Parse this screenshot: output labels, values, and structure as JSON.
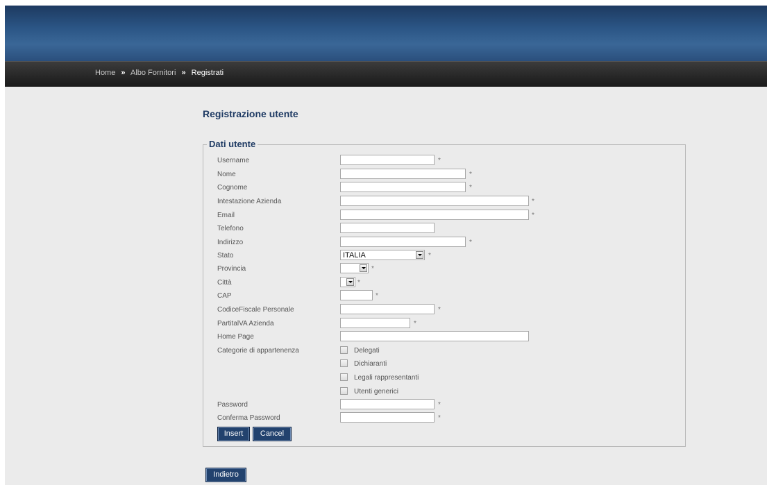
{
  "breadcrumb": {
    "items": [
      "Home",
      "Albo Fornitori",
      "Registrati"
    ],
    "separator": "»"
  },
  "page_title": "Registrazione utente",
  "form": {
    "legend": "Dati utente",
    "required_marker": "*",
    "fields": {
      "username": {
        "label": "Username",
        "value": ""
      },
      "nome": {
        "label": "Nome",
        "value": ""
      },
      "cognome": {
        "label": "Cognome",
        "value": ""
      },
      "intestazione": {
        "label": "Intestazione Azienda",
        "value": ""
      },
      "email": {
        "label": "Email",
        "value": ""
      },
      "telefono": {
        "label": "Telefono",
        "value": ""
      },
      "indirizzo": {
        "label": "Indirizzo",
        "value": ""
      },
      "stato": {
        "label": "Stato",
        "value": "ITALIA"
      },
      "provincia": {
        "label": "Provincia",
        "value": ""
      },
      "citta": {
        "label": "Città",
        "value": ""
      },
      "cap": {
        "label": "CAP",
        "value": ""
      },
      "codice_fiscale": {
        "label": "CodiceFiscale Personale",
        "value": ""
      },
      "partita_iva": {
        "label": "PartitalVA Azienda",
        "value": ""
      },
      "home_page": {
        "label": "Home Page",
        "value": ""
      },
      "categorie": {
        "label": "Categorie di appartenenza",
        "options": [
          {
            "label": "Delegati",
            "checked": false
          },
          {
            "label": "Dichiaranti",
            "checked": false
          },
          {
            "label": "Legali rappresentanti",
            "checked": false
          },
          {
            "label": "Utenti generici",
            "checked": false
          }
        ]
      },
      "password": {
        "label": "Password",
        "value": ""
      },
      "conferma_password": {
        "label": "Conferma Password",
        "value": ""
      }
    },
    "buttons": {
      "insert": "Insert",
      "cancel": "Cancel"
    }
  },
  "back_button": "Indietro",
  "colors": {
    "accent": "#22426e",
    "title": "#1e3a63",
    "content_bg": "#ebebeb",
    "navbar": "#262626",
    "banner": "#2b5585"
  }
}
